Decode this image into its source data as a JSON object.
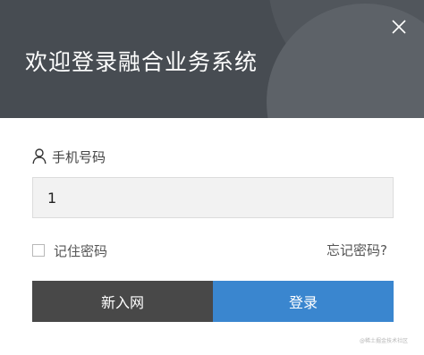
{
  "header": {
    "title": "欢迎登录融合业务系统",
    "background_color": "#474c52",
    "close_icon": "close-icon"
  },
  "form": {
    "phone": {
      "label": "手机号码",
      "icon": "user-icon",
      "value": "1"
    },
    "remember": {
      "label": "记住密码",
      "checked": false
    },
    "forgot_link": "忘记密码?"
  },
  "buttons": {
    "register_label": "新入网",
    "register_color": "#484848",
    "login_label": "登录",
    "login_color": "#3a86cf"
  },
  "watermark": "@稀土掘金技术社区"
}
